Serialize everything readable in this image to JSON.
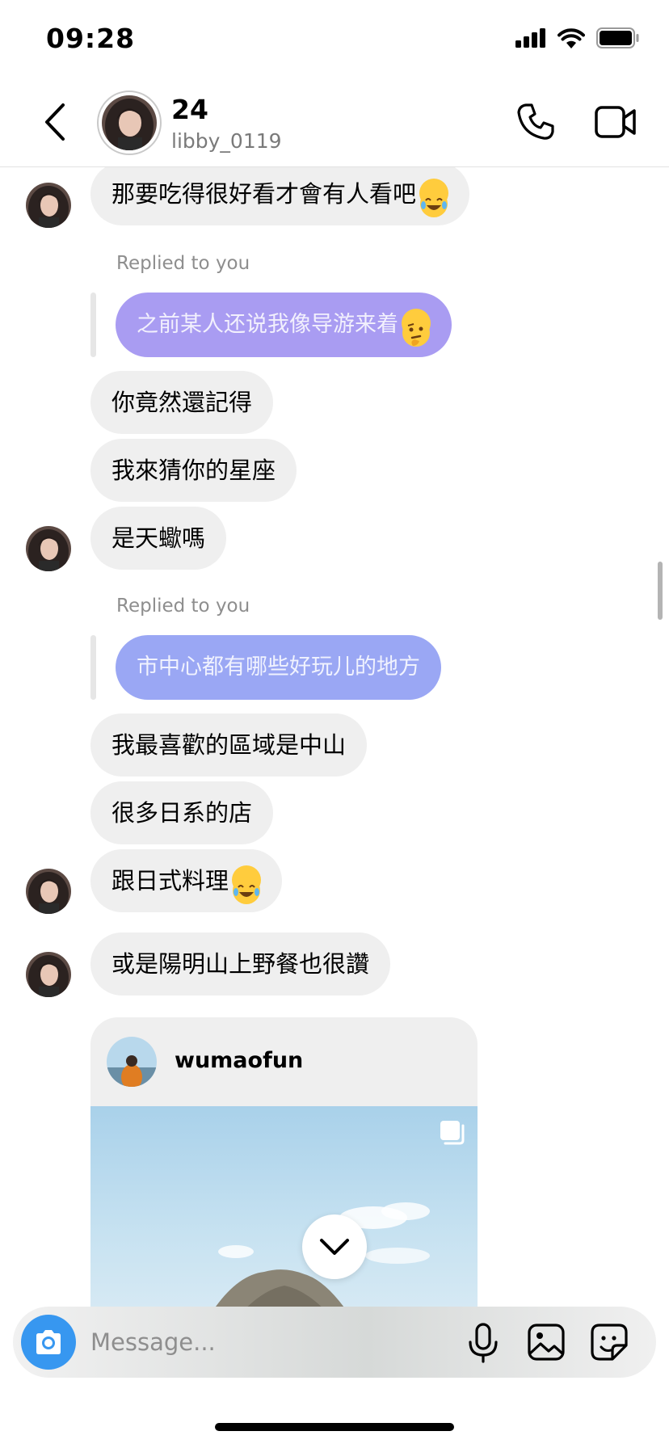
{
  "status_bar": {
    "time": "09:28",
    "icons": [
      "signal-icon",
      "wifi-icon",
      "battery-icon"
    ]
  },
  "header": {
    "back_icon": "chevron-left-icon",
    "name": "24",
    "username": "libby_0119",
    "call_icon": "phone-icon",
    "video_icon": "video-camera-icon"
  },
  "messages": [
    {
      "type": "incoming",
      "text": "那要吃得很好看才會有人看吧",
      "emoji": "face-with-tears-of-joy"
    },
    {
      "type": "reply_context",
      "label": "Replied to you",
      "text": "之前某人还说我像导游来着",
      "emoji": "thinking-face",
      "color": "#a99cf2"
    },
    {
      "type": "incoming",
      "text": "你竟然還記得"
    },
    {
      "type": "incoming",
      "text": "我來猜你的星座"
    },
    {
      "type": "incoming",
      "text": "是天蠍嗎"
    },
    {
      "type": "reply_context",
      "label": "Replied to you",
      "text": "市中心都有哪些好玩儿的地方",
      "color": "#9aa7f4"
    },
    {
      "type": "incoming",
      "text": "我最喜歡的區域是中山"
    },
    {
      "type": "incoming",
      "text": "很多日系的店"
    },
    {
      "type": "incoming",
      "text": "跟日式料理",
      "emoji": "face-with-tears-of-joy"
    },
    {
      "type": "incoming",
      "text": "或是陽明山上野餐也很讚"
    }
  ],
  "shared_post": {
    "username": "wumaofun",
    "multi_icon": "carousel-icon"
  },
  "scroll_down_icon": "chevron-down-icon",
  "composer": {
    "placeholder": "Message...",
    "camera_icon": "camera-icon",
    "mic_icon": "microphone-icon",
    "gallery_icon": "image-icon",
    "sticker_icon": "sticker-icon"
  },
  "colors": {
    "accent": "#3797f0",
    "incoming_bubble": "#efefef"
  }
}
